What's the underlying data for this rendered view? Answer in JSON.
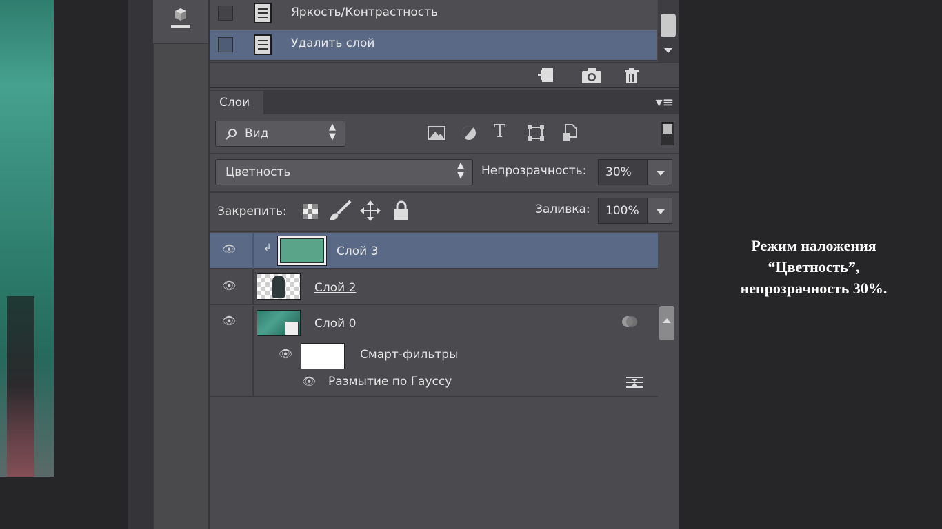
{
  "history": {
    "items": [
      {
        "label": "Яркость/Контрастность",
        "selected": false
      },
      {
        "label": "Удалить слой",
        "selected": true
      }
    ],
    "footer_icons": [
      "new-document-from-state-icon",
      "camera-icon",
      "trash-icon"
    ]
  },
  "layers_panel": {
    "tab_label": "Слои",
    "filter": {
      "label": "Вид",
      "icon": "search-icon"
    },
    "filter_icons": [
      "image-filter-icon",
      "adjustment-filter-icon",
      "type-filter-icon",
      "shape-filter-icon",
      "smart-object-filter-icon"
    ],
    "blend_mode": "Цветность",
    "opacity_label": "Непрозрачность:",
    "opacity_value": "30%",
    "lock_label": "Закрепить:",
    "lock_icons": [
      "lock-transparency-icon",
      "lock-image-icon",
      "lock-position-icon",
      "lock-all-icon"
    ],
    "fill_label": "Заливка:",
    "fill_value": "100%",
    "layers": [
      {
        "name": "Слой 3",
        "selected": true,
        "clipped": true,
        "thumb_color": "#5aa58a"
      },
      {
        "name": "Слой 2",
        "selected": false
      },
      {
        "name": "Слой 0",
        "selected": false,
        "smart_object": true
      },
      {
        "name": "Смарт-фильтры",
        "sub": true
      },
      {
        "name": "Размытие по Гауссу",
        "filter": true
      }
    ]
  },
  "caption": {
    "line1": "Режим наложения",
    "line2": "“Цветность”,",
    "line3": "непрозрачность 30%."
  },
  "colors": {
    "selection": "#5a6a86",
    "panel": "#4b4a4e"
  }
}
